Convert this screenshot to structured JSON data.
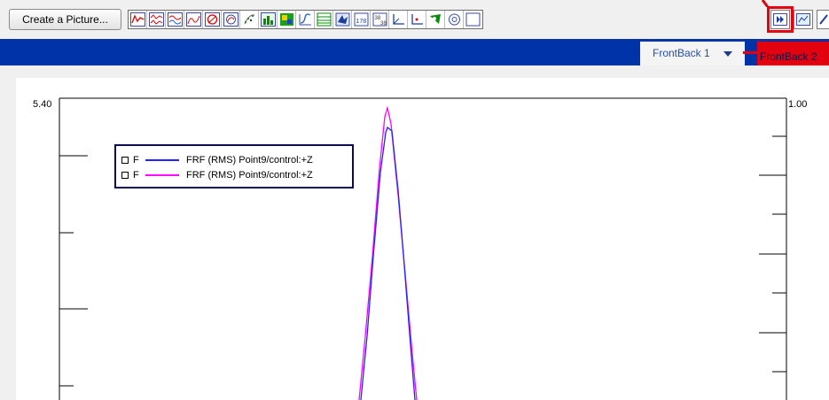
{
  "toolbar": {
    "create_label": "Create a Picture...",
    "icons": [
      "line-chart-icon",
      "multi-line-icon",
      "waveform-icon",
      "spectrum-icon",
      "nyquist-icon",
      "polar-icon",
      "scatter-icon",
      "bar-chart-icon",
      "colormap-icon",
      "curve-icon",
      "table-icon",
      "data-icon",
      "numeric-icon",
      "matrix-icon",
      "axis-icon",
      "axis-xy-icon",
      "shape-icon",
      "target-icon",
      "blank-icon"
    ],
    "right_icons": [
      "play-forward-icon",
      "picture-icon",
      "edit-icon"
    ]
  },
  "tabs": {
    "active": "FrontBack 1",
    "next": "FrontBack 2"
  },
  "plot": {
    "left_axis_top": "5.40",
    "right_axis_top": "1.00",
    "legend": [
      {
        "flag": "F",
        "label": "FRF (RMS) Point9/control:+Z",
        "color": "#2222ff"
      },
      {
        "flag": "F",
        "label": "FRF (RMS) Point9/control:+Z",
        "color": "#ff00ff"
      }
    ]
  },
  "colors": {
    "tabbar": "#0033a8",
    "highlight": "#e3000f",
    "trace_blue": "#2222ff",
    "trace_magenta": "#ff00ff"
  }
}
